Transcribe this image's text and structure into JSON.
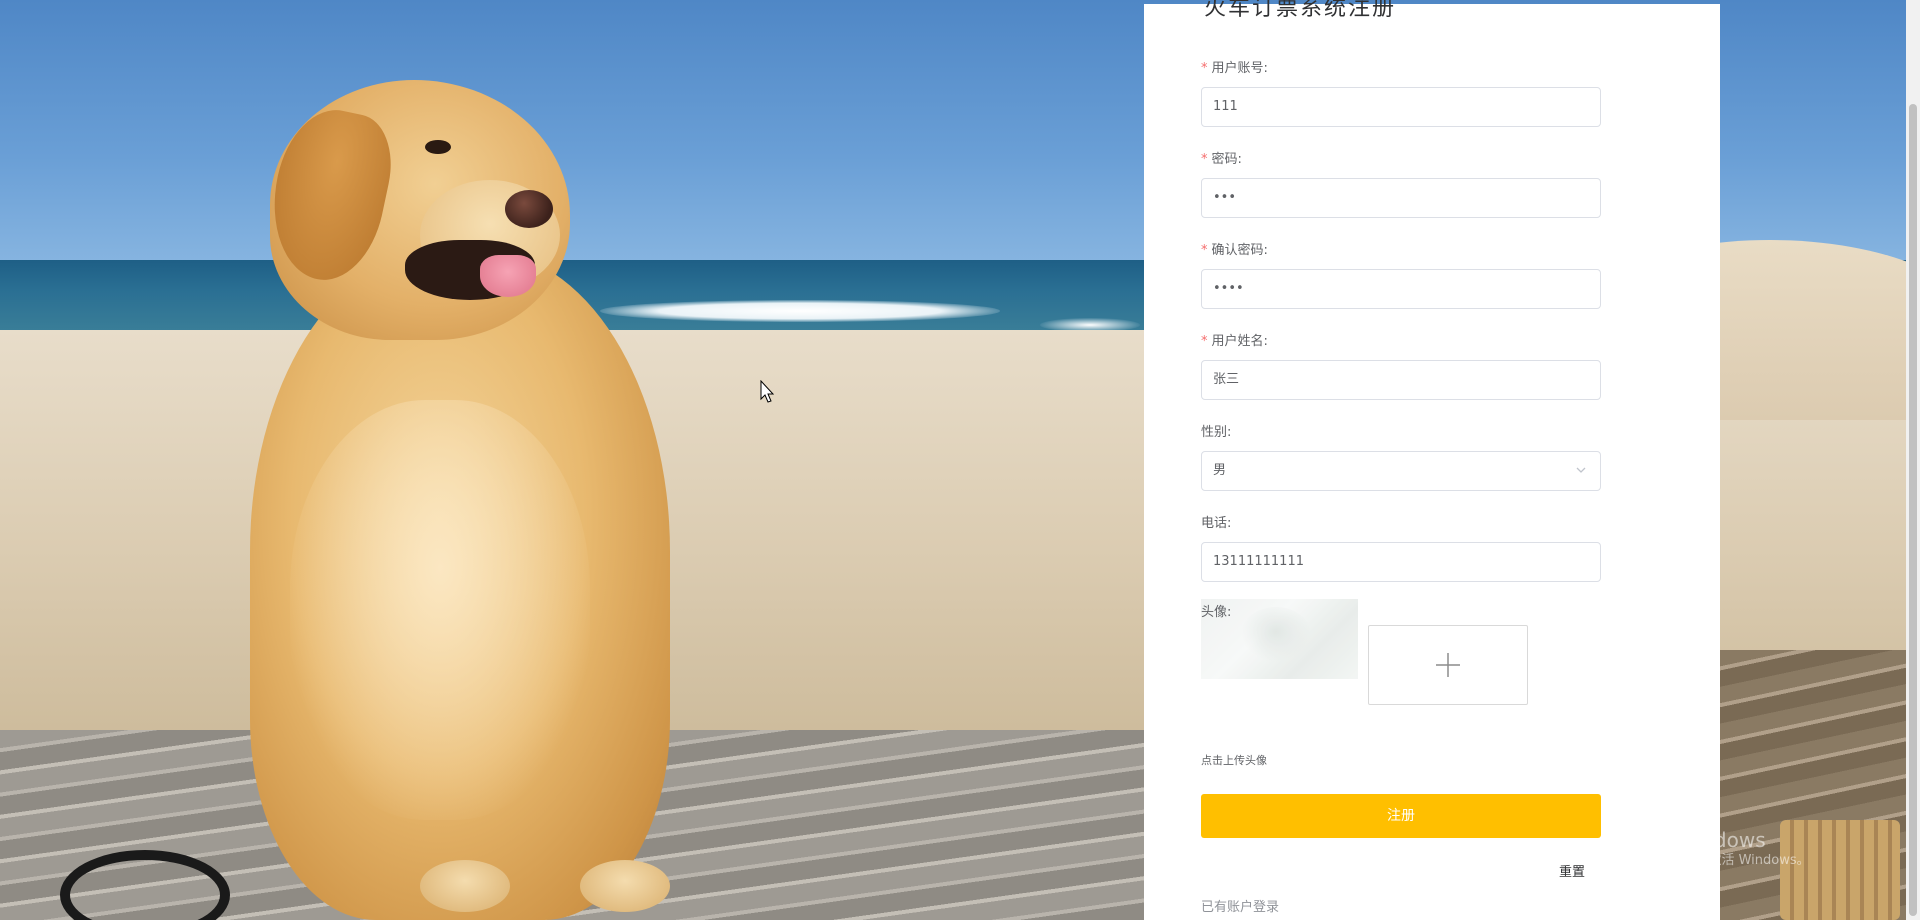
{
  "form": {
    "title": "火车订票系统注册",
    "fields": [
      {
        "label": "用户账号:",
        "required": true,
        "value": "111",
        "type": "text"
      },
      {
        "label": "密码:",
        "required": true,
        "value": "•••",
        "type": "password"
      },
      {
        "label": "确认密码:",
        "required": true,
        "value": "••••",
        "type": "password"
      },
      {
        "label": "用户姓名:",
        "required": true,
        "value": "张三",
        "type": "text"
      },
      {
        "label": "性别:",
        "required": false,
        "value": "男",
        "type": "select"
      },
      {
        "label": "电话:",
        "required": false,
        "value": "13111111111",
        "type": "text"
      }
    ],
    "avatar_label": "头像:",
    "upload_hint": "点击上传头像",
    "submit_label": "注册",
    "reset_label": "重置",
    "login_link": "已有账户登录",
    "required_mark": "*"
  },
  "watermark": {
    "line1": "激活 Windows",
    "line2": "转到“设置”以激活 Windows。"
  },
  "colors": {
    "accent": "#ffbf00",
    "required": "#f56c6c",
    "panel": "#ffffff"
  },
  "icons": {
    "select_arrow": "chevron-down-icon",
    "upload": "plus-icon",
    "cursor": "mouse-pointer-icon"
  }
}
